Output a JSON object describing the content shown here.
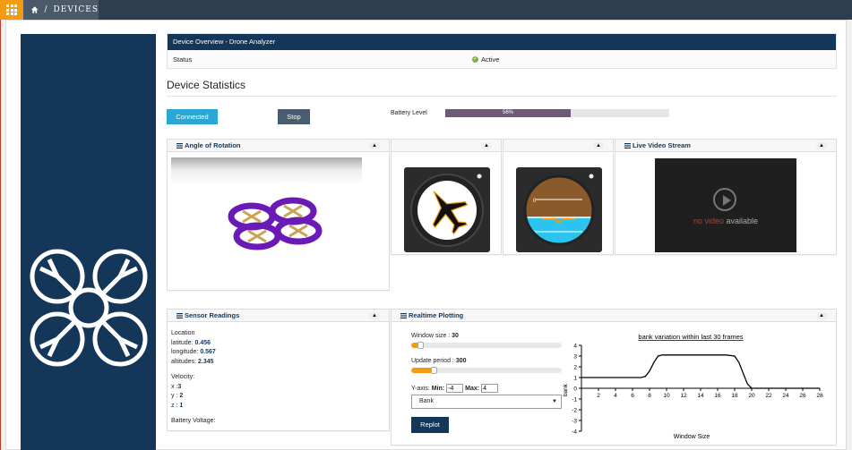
{
  "topbar": {
    "breadcrumb_sep": "/",
    "breadcrumb": "DEVICES",
    "apps_icon": "grid-icon",
    "home_icon": "home-icon"
  },
  "overview": {
    "title": "Device Overview - Drone Analyzer",
    "status_label": "Status",
    "status_value": "Active"
  },
  "stats": {
    "title": "Device Statistics",
    "connected_label": "Connected",
    "stop_label": "Stop",
    "battery_label": "Battery Level",
    "battery_percent": 56,
    "battery_text": "56%"
  },
  "panels": {
    "angle_title": "Angle of Rotation",
    "video_title": "Live Video Stream",
    "sensor_title": "Sensor Readings",
    "plot_title": "Realtime Plotting",
    "collapse_glyph": "▲"
  },
  "video": {
    "no": "no video ",
    "available": "available"
  },
  "sensor": {
    "location_label": "Location",
    "latitude_label": "latitude:",
    "latitude": "0.456",
    "longitude_label": "longitude:",
    "longitude": "0.567",
    "altitude_label": "altitudes:",
    "altitude": "2.345",
    "velocity_label": "Velocity:",
    "x_label": "x :",
    "x": "3",
    "y_label": "y :",
    "y": "2",
    "z_label": "z :",
    "z": "1",
    "battery_voltage_label": "Battery Voltage:"
  },
  "plot_controls": {
    "window_size_label": "Window size :",
    "window_size": "30",
    "update_period_label": "Update period :",
    "update_period": "300",
    "yaxis_label": "Y-axis:",
    "min_label": "Min:",
    "min_value": "-4",
    "max_label": "Max:",
    "max_value": "4",
    "select_value": "Bank",
    "replot_label": "Replot"
  },
  "attitude": {
    "pitch_labels": [
      "0",
      "0"
    ],
    "heading_color": "#f39c12"
  },
  "colors": {
    "navy": "#143659",
    "accent": "#29a8d6",
    "orange": "#f39c12",
    "battery": "#6e5a75"
  },
  "chart_data": {
    "type": "line",
    "title": "bank variation within last 30 frames",
    "xlabel": "Window Size",
    "ylabel": "bank",
    "xlim": [
      0,
      28
    ],
    "ylim": [
      -4,
      4
    ],
    "x_ticks": [
      2,
      4,
      6,
      8,
      10,
      12,
      14,
      16,
      18,
      20,
      22,
      24,
      26,
      28
    ],
    "y_ticks": [
      4,
      3,
      2,
      1,
      0,
      -1,
      -2,
      -3,
      -4
    ],
    "x": [
      0,
      1,
      2,
      3,
      4,
      5,
      6,
      7,
      7.5,
      8,
      8.5,
      9,
      9.5,
      10,
      11,
      12,
      13,
      14,
      15,
      16,
      17,
      18,
      18.5,
      19,
      19.5,
      20,
      21,
      22,
      23,
      24,
      25,
      26,
      27,
      28
    ],
    "values": [
      1,
      1,
      1,
      1,
      1,
      1,
      1,
      1,
      1.1,
      1.6,
      2.4,
      3.0,
      3.1,
      3.1,
      3.1,
      3.1,
      3.1,
      3.1,
      3.1,
      3.1,
      3.1,
      3.0,
      2.4,
      1.4,
      0.4,
      0,
      0,
      0,
      0,
      0,
      0,
      0,
      0,
      0
    ]
  }
}
